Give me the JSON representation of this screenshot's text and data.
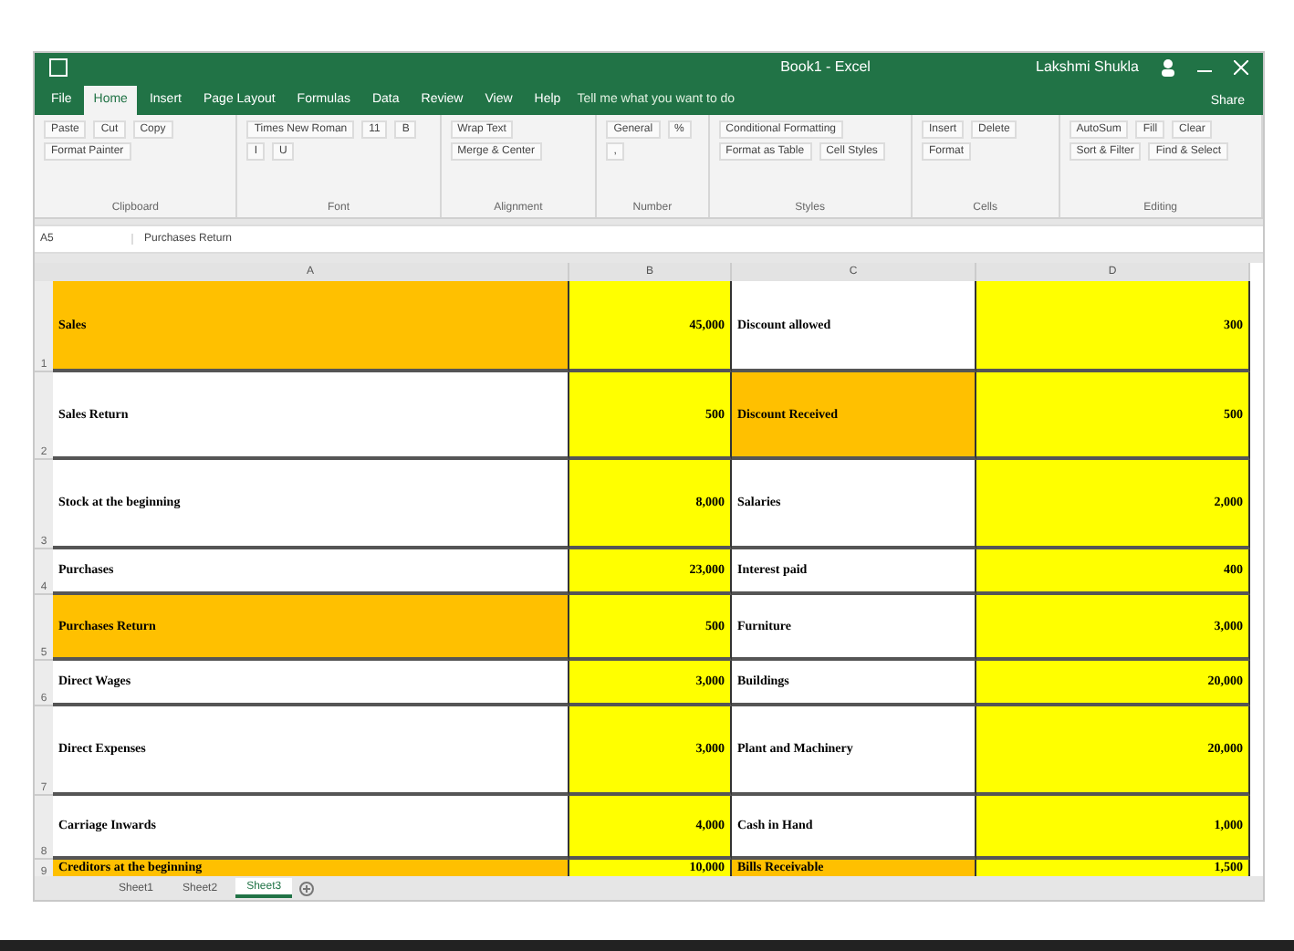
{
  "window": {
    "title": "Book1 - Excel",
    "user": "Lakshmi Shukla"
  },
  "ribbon_tabs": [
    {
      "label": "File",
      "selected": false
    },
    {
      "label": "Home",
      "selected": true
    },
    {
      "label": "Insert",
      "selected": false
    },
    {
      "label": "Page Layout",
      "selected": false
    },
    {
      "label": "Formulas",
      "selected": false
    },
    {
      "label": "Data",
      "selected": false
    },
    {
      "label": "Review",
      "selected": false
    },
    {
      "label": "View",
      "selected": false
    },
    {
      "label": "Help",
      "selected": false
    }
  ],
  "tell_me": {
    "placeholder": "Tell me what you want to do"
  },
  "share": "Share",
  "ribbon_groups": [
    {
      "name": "Clipboard",
      "items": [
        "Paste",
        "Cut",
        "Copy",
        "Format Painter"
      ]
    },
    {
      "name": "Font",
      "items": [
        "Times New Roman",
        "11",
        "B",
        "I",
        "U"
      ]
    },
    {
      "name": "Alignment",
      "items": [
        "Wrap Text",
        "Merge & Center"
      ]
    },
    {
      "name": "Number",
      "items": [
        "General",
        "%",
        ","
      ]
    },
    {
      "name": "Styles",
      "items": [
        "Conditional Formatting",
        "Format as Table",
        "Cell Styles"
      ]
    },
    {
      "name": "Cells",
      "items": [
        "Insert",
        "Delete",
        "Format"
      ]
    },
    {
      "name": "Editing",
      "items": [
        "AutoSum",
        "Fill",
        "Clear",
        "Sort & Filter",
        "Find & Select"
      ]
    }
  ],
  "formula_bar": {
    "name_box": "A5",
    "formula": "Purchases Return"
  },
  "columns": [
    "A",
    "B",
    "C",
    "D"
  ],
  "rows": [
    {
      "number": "1",
      "cells": [
        {
          "text": "Sales",
          "color": "#ffc000"
        },
        {
          "text": "45,000",
          "color": "#ffff00"
        },
        {
          "text": "Discount allowed",
          "color": "#ffffff"
        },
        {
          "text": "300",
          "color": "#ffff00"
        }
      ]
    },
    {
      "number": "2",
      "cells": [
        {
          "text": "Sales Return",
          "color": "#ffffff"
        },
        {
          "text": "500",
          "color": "#ffff00"
        },
        {
          "text": "Discount Received",
          "color": "#ffc000"
        },
        {
          "text": "500",
          "color": "#ffff00"
        }
      ]
    },
    {
      "number": "3",
      "cells": [
        {
          "text": "Stock at the beginning",
          "color": "#ffffff"
        },
        {
          "text": "8,000",
          "color": "#ffff00"
        },
        {
          "text": "Salaries",
          "color": "#ffffff"
        },
        {
          "text": "2,000",
          "color": "#ffff00"
        }
      ]
    },
    {
      "number": "4",
      "cells": [
        {
          "text": "Purchases",
          "color": "#ffffff"
        },
        {
          "text": "23,000",
          "color": "#ffff00"
        },
        {
          "text": "Interest paid",
          "color": "#ffffff"
        },
        {
          "text": "400",
          "color": "#ffff00"
        }
      ]
    },
    {
      "number": "5",
      "cells": [
        {
          "text": "Purchases Return",
          "color": "#ffc000"
        },
        {
          "text": "500",
          "color": "#ffff00"
        },
        {
          "text": "Furniture",
          "color": "#ffffff"
        },
        {
          "text": "3,000",
          "color": "#ffff00"
        }
      ]
    },
    {
      "number": "6",
      "cells": [
        {
          "text": "Direct Wages",
          "color": "#ffffff"
        },
        {
          "text": "3,000",
          "color": "#ffff00"
        },
        {
          "text": "Buildings",
          "color": "#ffffff"
        },
        {
          "text": "20,000",
          "color": "#ffff00"
        }
      ]
    },
    {
      "number": "7",
      "cells": [
        {
          "text": "Direct Expenses",
          "color": "#ffffff"
        },
        {
          "text": "3,000",
          "color": "#ffff00"
        },
        {
          "text": "Plant and Machinery",
          "color": "#ffffff"
        },
        {
          "text": "20,000",
          "color": "#ffff00"
        }
      ]
    },
    {
      "number": "8",
      "cells": [
        {
          "text": "Carriage Inwards",
          "color": "#ffffff"
        },
        {
          "text": "4,000",
          "color": "#ffff00"
        },
        {
          "text": "Cash in Hand",
          "color": "#ffffff"
        },
        {
          "text": "1,000",
          "color": "#ffff00"
        }
      ]
    },
    {
      "number": "9",
      "cells": [
        {
          "text": "Creditors at the beginning",
          "color": "#ffc000"
        },
        {
          "text": "10,000",
          "color": "#ffff00"
        },
        {
          "text": "Bills Receivable",
          "color": "#ffc000"
        },
        {
          "text": "1,500",
          "color": "#ffff00"
        }
      ]
    }
  ],
  "sheets": [
    {
      "label": "Sheet1",
      "selected": false
    },
    {
      "label": "Sheet2",
      "selected": false
    },
    {
      "label": "Sheet3",
      "selected": true
    }
  ]
}
